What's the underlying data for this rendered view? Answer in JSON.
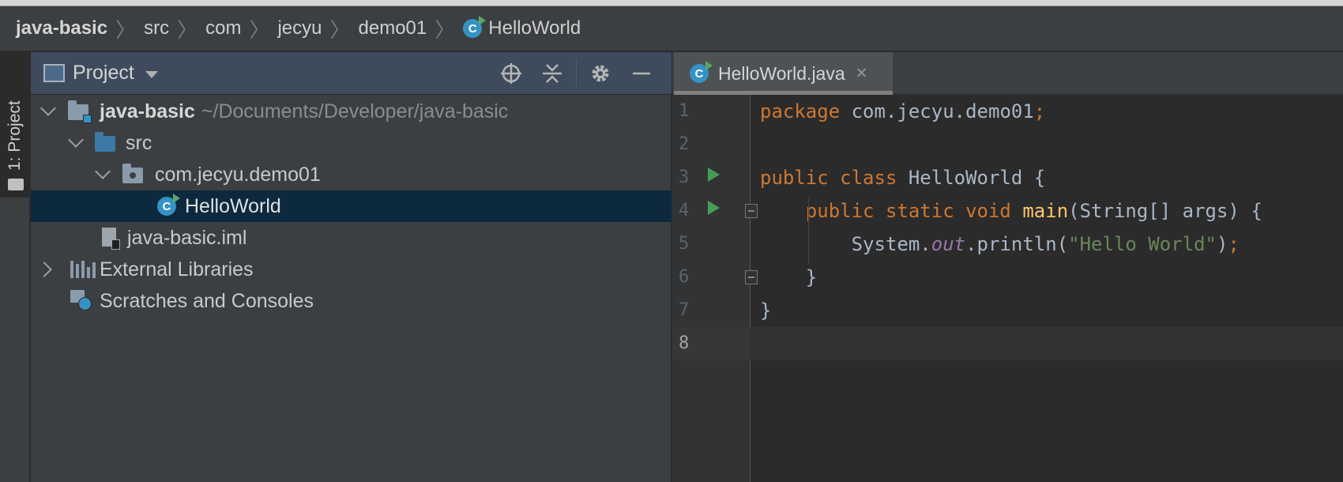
{
  "breadcrumbs": [
    "java-basic",
    "src",
    "com",
    "jecyu",
    "demo01",
    "HelloWorld"
  ],
  "tool_stripe": {
    "label": "1: Project"
  },
  "project_panel": {
    "title": "Project",
    "icons": [
      "locate-icon",
      "collapse-all-icon",
      "gear-icon",
      "hide-icon"
    ]
  },
  "tree": [
    {
      "label": "java-basic",
      "path": "~/Documents/Developer/java-basic",
      "expanded": true
    },
    {
      "label": "src",
      "expanded": true
    },
    {
      "label": "com.jecyu.demo01",
      "expanded": true
    },
    {
      "label": "HelloWorld",
      "selected": true
    },
    {
      "label": "java-basic.iml"
    },
    {
      "label": "External Libraries",
      "expanded": false
    },
    {
      "label": "Scratches and Consoles"
    }
  ],
  "editor_tab": {
    "label": "HelloWorld.java",
    "close": "×"
  },
  "editor": {
    "line_numbers": [
      "1",
      "2",
      "3",
      "4",
      "5",
      "6",
      "7",
      "8"
    ],
    "current_line": 8,
    "tokens": {
      "l1_kw": "package",
      "l1_pkg": " com.jecyu.demo01",
      "l1_semi": ";",
      "l3_kw": "public class",
      "l3_rest": " HelloWorld {",
      "l4_kw": "public static void",
      "l4_fn": "main",
      "l4_rest": "(String[] args) {",
      "l5_sys": "System.",
      "l5_out": "out",
      "l5_println": ".println(",
      "l5_str": "\"Hello World\"",
      "l5_close": ")",
      "l5_semi": ";",
      "l6": "}",
      "l7": "}"
    }
  },
  "colors": {
    "keyword": "#cc7832",
    "identifier": "#a9b7c6",
    "method": "#ffc66d",
    "field": "#9876aa",
    "string": "#6a8759",
    "selection": "#0d293e",
    "run_gutter": "#499c54"
  }
}
